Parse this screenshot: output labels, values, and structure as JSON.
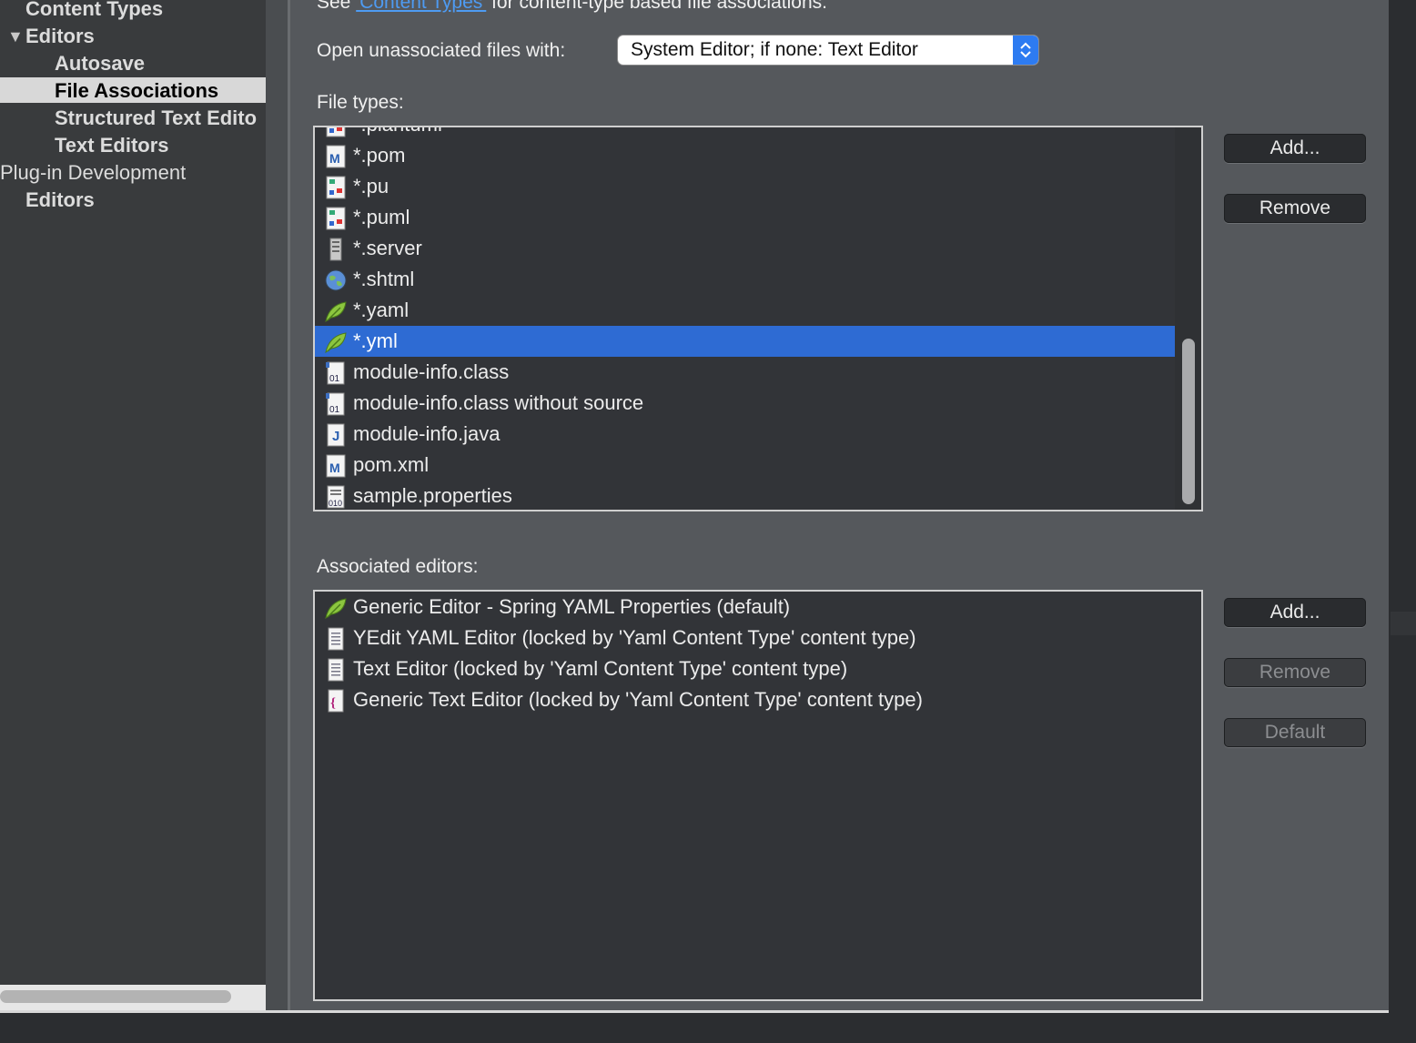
{
  "sidebar": {
    "items": [
      {
        "label": "Content Types"
      },
      {
        "label": "Editors",
        "expanded": true
      },
      {
        "label": "Autosave"
      },
      {
        "label": "File Associations",
        "selected": true
      },
      {
        "label": "Structured Text Edito"
      },
      {
        "label": "Text Editors"
      },
      {
        "label": "Plug-in Development"
      },
      {
        "label": "Editors"
      }
    ],
    "expand_arrow": "▼"
  },
  "main": {
    "see_prefix": "See ",
    "see_link": "'Content Types'",
    "see_suffix": " for content-type based file associations.",
    "open_unassociated_label": "Open unassociated files with:",
    "open_unassociated_value": "System Editor; if none: Text Editor",
    "file_types_label": "File types:",
    "file_types": [
      {
        "label": "*.plantuml",
        "icon": "plantuml-icon"
      },
      {
        "label": "*.pom",
        "icon": "maven-icon"
      },
      {
        "label": "*.pu",
        "icon": "plantuml-icon"
      },
      {
        "label": "*.puml",
        "icon": "plantuml-icon"
      },
      {
        "label": "*.server",
        "icon": "server-icon"
      },
      {
        "label": "*.shtml",
        "icon": "globe-icon"
      },
      {
        "label": "*.yaml",
        "icon": "spring-leaf-icon"
      },
      {
        "label": "*.yml",
        "icon": "spring-leaf-icon",
        "selected": true
      },
      {
        "label": "module-info.class",
        "icon": "class-file-icon"
      },
      {
        "label": "module-info.class without source",
        "icon": "class-file-icon"
      },
      {
        "label": "module-info.java",
        "icon": "java-file-icon"
      },
      {
        "label": "pom.xml",
        "icon": "maven-icon"
      },
      {
        "label": "sample.properties",
        "icon": "properties-file-icon"
      }
    ],
    "file_types_buttons": {
      "add": "Add...",
      "remove": "Remove"
    },
    "associated_editors_label": "Associated editors:",
    "associated_editors": [
      {
        "label": "Generic Editor - Spring YAML Properties (default)",
        "icon": "spring-leaf-icon"
      },
      {
        "label": "YEdit YAML Editor (locked by 'Yaml Content Type' content type)",
        "icon": "text-file-icon"
      },
      {
        "label": "Text Editor (locked by 'Yaml Content Type' content type)",
        "icon": "text-file-icon"
      },
      {
        "label": "Generic Text Editor (locked by 'Yaml Content Type' content type)",
        "icon": "generic-editor-icon"
      }
    ],
    "editor_buttons": {
      "add": "Add...",
      "remove": "Remove",
      "default": "Default"
    }
  },
  "colors": {
    "selection": "#2e6bd3",
    "link": "#4e9bf2",
    "stepper": "#2d7bf1"
  }
}
